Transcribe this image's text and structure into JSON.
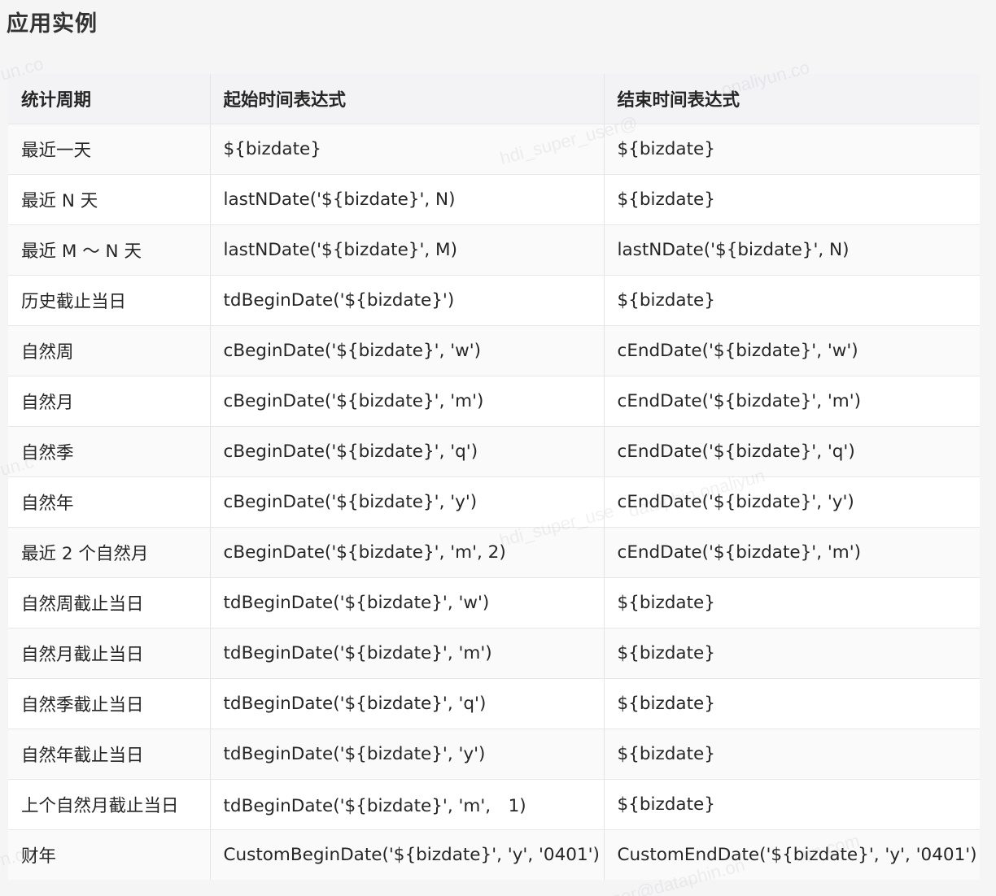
{
  "section": {
    "title": "应用实例"
  },
  "table": {
    "headers": [
      "统计周期",
      "起始时间表达式",
      "结束时间表达式"
    ],
    "rows": [
      [
        "最近一天",
        "${bizdate}",
        "${bizdate}"
      ],
      [
        "最近 N 天",
        "lastNDate('${bizdate}', N)",
        "${bizdate}"
      ],
      [
        "最近 M ～ N 天",
        "lastNDate('${bizdate}', M)",
        "lastNDate('${bizdate}', N)"
      ],
      [
        "历史截止当日",
        "tdBeginDate('${bizdate}')",
        "${bizdate}"
      ],
      [
        "自然周",
        "cBeginDate('${bizdate}', 'w')",
        "cEndDate('${bizdate}', 'w')"
      ],
      [
        "自然月",
        "cBeginDate('${bizdate}', 'm')",
        "cEndDate('${bizdate}', 'm')"
      ],
      [
        "自然季",
        "cBeginDate('${bizdate}', 'q')",
        "cEndDate('${bizdate}', 'q')"
      ],
      [
        "自然年",
        "cBeginDate('${bizdate}', 'y')",
        "cEndDate('${bizdate}', 'y')"
      ],
      [
        "最近 2 个自然月",
        "cBeginDate('${bizdate}', 'm', 2)",
        "cEndDate('${bizdate}', 'm')"
      ],
      [
        "自然周截止当日",
        "tdBeginDate('${bizdate}', 'w')",
        "${bizdate}"
      ],
      [
        "自然月截止当日",
        "tdBeginDate('${bizdate}', 'm')",
        "${bizdate}"
      ],
      [
        "自然季截止当日",
        "tdBeginDate('${bizdate}', 'q')",
        "${bizdate}"
      ],
      [
        "自然年截止当日",
        "tdBeginDate('${bizdate}', 'y')",
        "${bizdate}"
      ],
      [
        "上个自然月截止当日",
        "tdBeginDate('${bizdate}', 'm',　1)",
        "${bizdate}"
      ],
      [
        "财年",
        "CustomBeginDate('${bizdate}', 'y', '0401')",
        "CustomEndDate('${bizdate}', 'y', '0401')"
      ]
    ]
  },
  "watermarks": [
    "un.co",
    "onaliyun.co",
    "hdi_super_user@",
    "un.c",
    "dataphin.onaliyun",
    "hdi_super_use",
    "n.co",
    "ser@dataphin.on",
    "un.com"
  ]
}
